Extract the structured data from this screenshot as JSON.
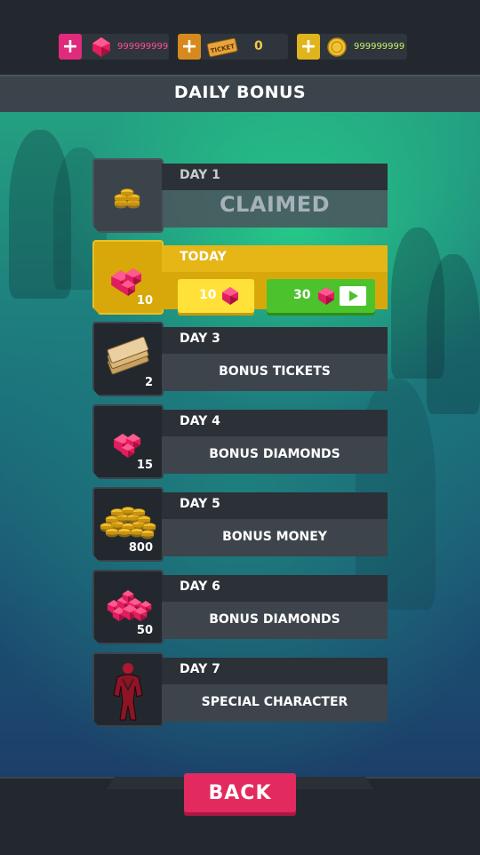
{
  "currency": {
    "gems": {
      "value": "999999999",
      "icon": "gem-icon",
      "color": "#e02a7b"
    },
    "tickets": {
      "value": "0",
      "icon": "ticket-icon",
      "icon_text": "TICKET",
      "color": "#d68a1e"
    },
    "coins": {
      "value": "999999999",
      "icon": "coin-icon",
      "color": "#e0b41c"
    }
  },
  "header": {
    "title": "DAILY BONUS"
  },
  "days": [
    {
      "day": "DAY 1",
      "status": "CLAIMED",
      "icon": "coins-stack-icon"
    },
    {
      "day": "TODAY",
      "icon": "gems-icon",
      "quantity": "10",
      "free_amount": "10",
      "ad_amount": "30",
      "ad_icon": "video-play-icon"
    },
    {
      "day": "DAY 3",
      "desc": "BONUS TICKETS",
      "icon": "tickets-icon",
      "quantity": "2"
    },
    {
      "day": "DAY 4",
      "desc": "BONUS DIAMONDS",
      "icon": "gems-icon",
      "quantity": "15"
    },
    {
      "day": "DAY 5",
      "desc": "BONUS MONEY",
      "icon": "coin-pile-icon",
      "quantity": "800"
    },
    {
      "day": "DAY 6",
      "desc": "BONUS DIAMONDS",
      "icon": "gem-pile-icon",
      "quantity": "50"
    },
    {
      "day": "DAY 7",
      "desc": "SPECIAL CHARACTER",
      "icon": "character-icon"
    }
  ],
  "footer": {
    "back_label": "BACK"
  },
  "colors": {
    "highlight": "#d8a80a",
    "free_button": "#ffe13a",
    "ad_button": "#4cc22c",
    "back_button": "#e22a5e"
  }
}
